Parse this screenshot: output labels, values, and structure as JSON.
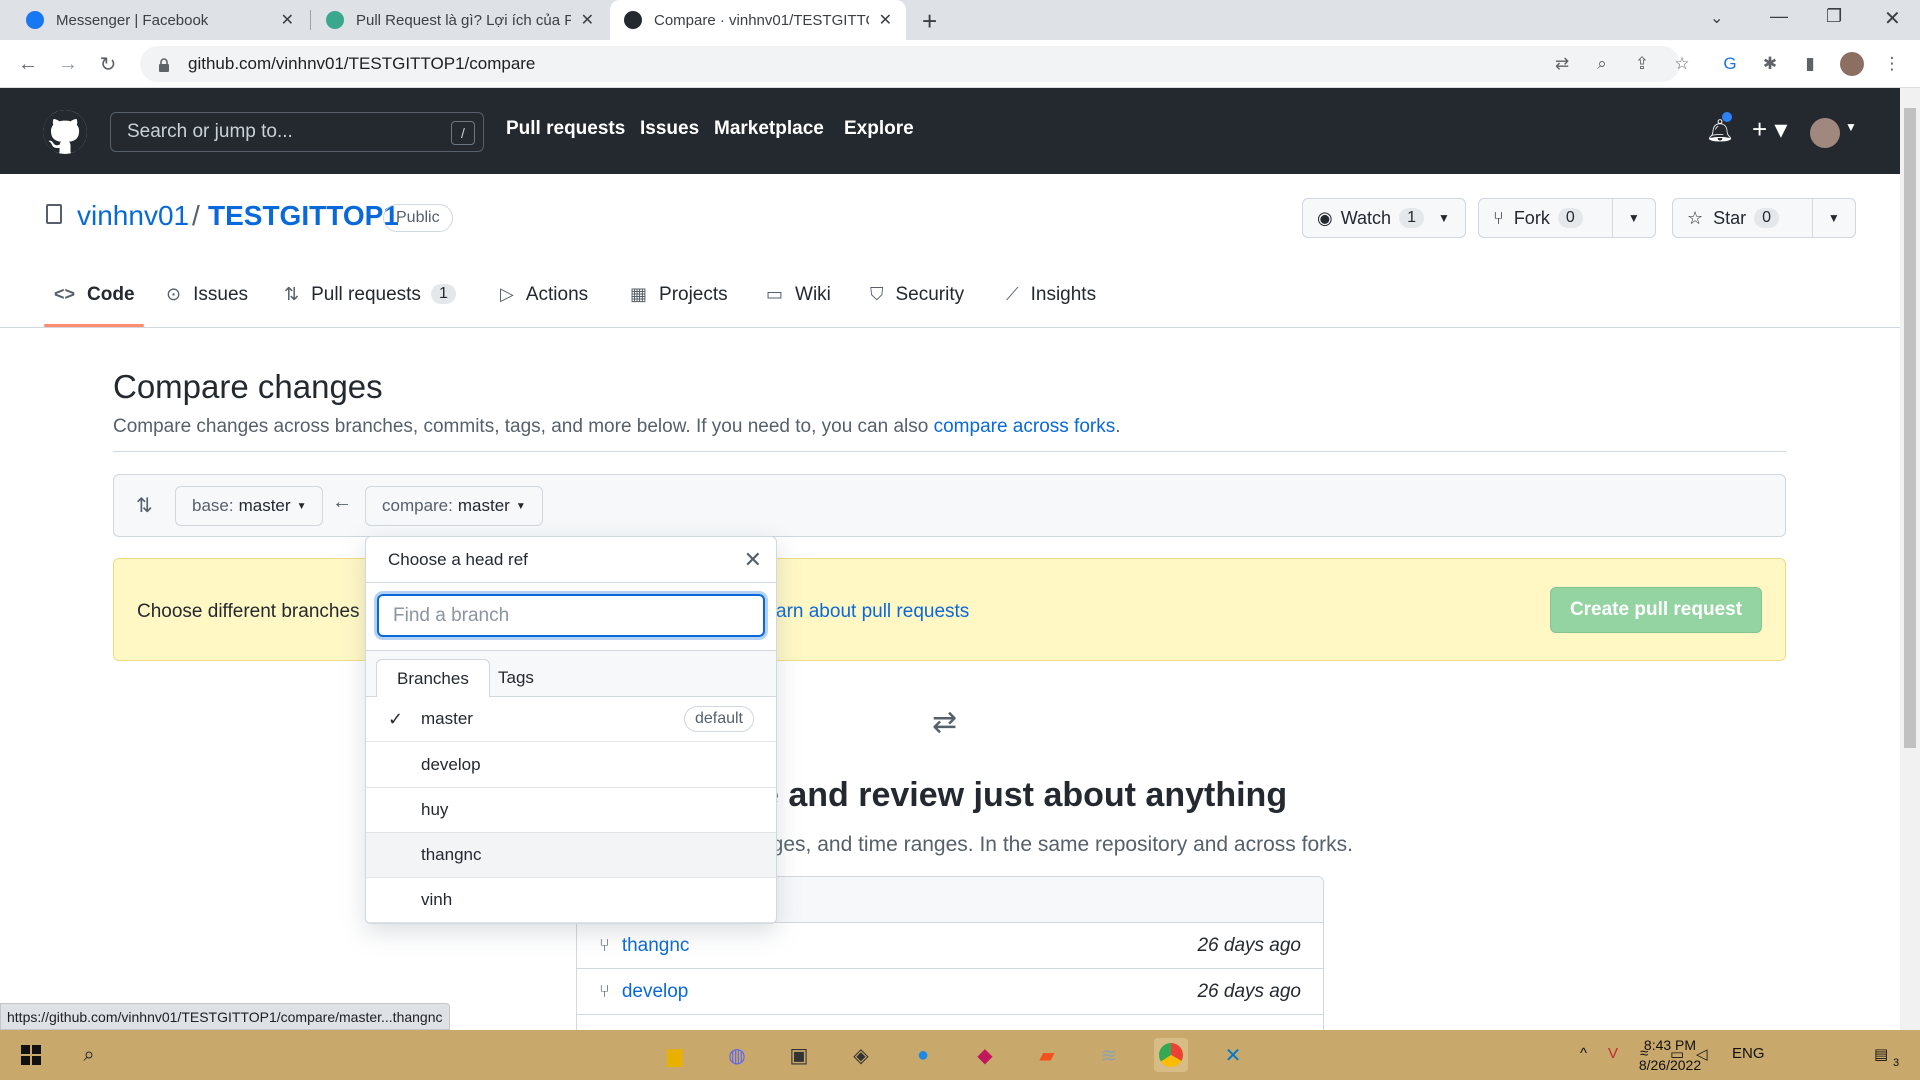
{
  "browser": {
    "tabs": [
      {
        "title": "Messenger | Facebook",
        "icon_color": "#1877f2",
        "active": false
      },
      {
        "title": "Pull Request là gì? Lợi ích của Pul",
        "icon_color": "#3aa88c",
        "active": false
      },
      {
        "title": "Compare · vinhnv01/TESTGITTOP",
        "icon_color": "#24292f",
        "active": true
      }
    ],
    "url": "github.com/vinhnv01/TESTGITTOP1/compare",
    "status_url": "https://github.com/vinhnv01/TESTGITTOP1/compare/master...thangnc"
  },
  "github_header": {
    "search_placeholder": "Search or jump to...",
    "search_key": "/",
    "nav": [
      "Pull requests",
      "Issues",
      "Marketplace",
      "Explore"
    ]
  },
  "repo": {
    "owner": "vinhnv01",
    "separator": "/",
    "name": "TESTGITTOP1",
    "visibility": "Public",
    "watch": {
      "label": "Watch",
      "count": "1"
    },
    "fork": {
      "label": "Fork",
      "count": "0"
    },
    "star": {
      "label": "Star",
      "count": "0"
    },
    "tabs": [
      {
        "label": "Code",
        "icon": "code-icon"
      },
      {
        "label": "Issues",
        "icon": "issue-icon"
      },
      {
        "label": "Pull requests",
        "icon": "pull-request-icon",
        "count": "1"
      },
      {
        "label": "Actions",
        "icon": "play-icon"
      },
      {
        "label": "Projects",
        "icon": "table-icon"
      },
      {
        "label": "Wiki",
        "icon": "book-icon"
      },
      {
        "label": "Security",
        "icon": "shield-icon"
      },
      {
        "label": "Insights",
        "icon": "graph-icon"
      }
    ]
  },
  "compare": {
    "title": "Compare changes",
    "description": "Compare changes across branches, commits, tags, and more below. If you need to, you can also ",
    "description_link": "compare across forks",
    "description_end": ".",
    "base_label": "base:",
    "base_value": "master",
    "compare_label": "compare:",
    "compare_value": "master",
    "flash_text": "Choose different branches",
    "flash_link": "arn about pull requests",
    "create_button": "Create pull request",
    "blank_title": "e and review just about anything",
    "blank_sub": "nges, and time ranges. In the same repository and across forks.",
    "recent_head": "s",
    "recent_branches": [
      {
        "name": "thangnc",
        "time": "26 days ago"
      },
      {
        "name": "develop",
        "time": "26 days ago"
      }
    ]
  },
  "dropdown": {
    "title": "Choose a head ref",
    "filter_placeholder": "Find a branch",
    "tabs": [
      "Branches",
      "Tags"
    ],
    "items": [
      {
        "name": "master",
        "selected": true,
        "badge": "default"
      },
      {
        "name": "develop"
      },
      {
        "name": "huy"
      },
      {
        "name": "thangnc",
        "hover": true
      },
      {
        "name": "vinh"
      }
    ]
  },
  "taskbar": {
    "language": "ENG",
    "time": "8:43 PM",
    "date": "8/26/2022",
    "notification_count": "3"
  }
}
